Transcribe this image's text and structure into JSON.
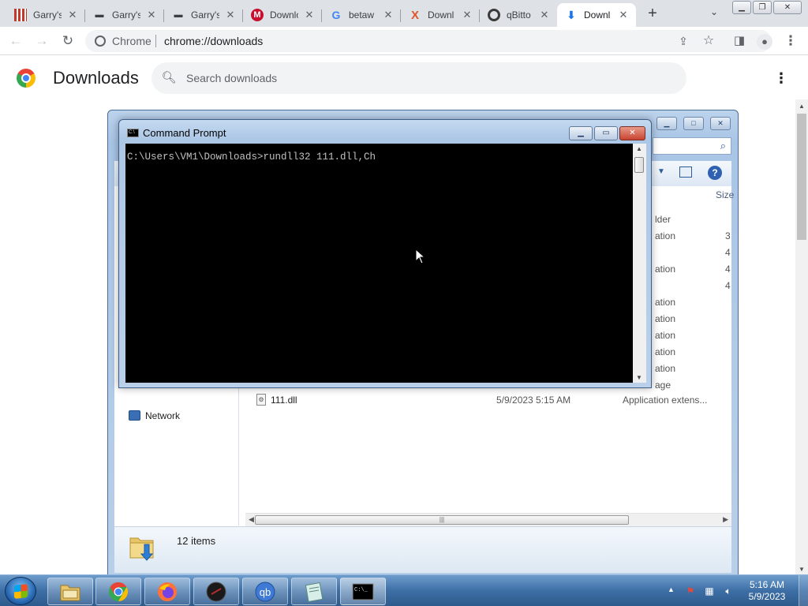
{
  "browser": {
    "tabs": [
      {
        "title": "Garry's",
        "favicon": "tartan-favicon"
      },
      {
        "title": "Garry's",
        "favicon": "dash-favicon"
      },
      {
        "title": "Garry's",
        "favicon": "dash-favicon"
      },
      {
        "title": "Downlo",
        "favicon": "malwarebytes-favicon"
      },
      {
        "title": "betaw",
        "favicon": "google-favicon"
      },
      {
        "title": "Downl",
        "favicon": "x-favicon"
      },
      {
        "title": "qBitto",
        "favicon": "qbittorrent-favicon"
      },
      {
        "title": "Downl",
        "favicon": "download-favicon",
        "active": true
      }
    ],
    "address": {
      "chip": "Chrome",
      "url": "chrome://downloads"
    }
  },
  "downloads_page": {
    "title": "Downloads",
    "search_placeholder": "Search downloads"
  },
  "explorer": {
    "column_size": "Size",
    "type_fragments": [
      "lder",
      "ation",
      "ation",
      "ation",
      "ation",
      "ation",
      "ation",
      "ation",
      "age"
    ],
    "size_fragments": [
      "3",
      "4",
      "4",
      "4"
    ],
    "file": {
      "name": "111.dll",
      "date": "5/9/2023 5:15 AM",
      "type": "Application extens..."
    },
    "nav_network": "Network",
    "status_count": "12 items"
  },
  "cmd": {
    "title": "Command Prompt",
    "line": "C:\\Users\\VM1\\Downloads>rundll32 111.dll,Ch"
  },
  "taskbar": {
    "apps": [
      "explorer",
      "chrome",
      "firefox",
      "app-dark",
      "qbittorrent",
      "notepad-like",
      "cmd"
    ],
    "time": "5:16 AM",
    "date": "5/9/2023"
  },
  "colors": {
    "tabstrip": "#dee1e6",
    "console_bg": "#000000",
    "console_text": "#c0c0c0",
    "taskbar": "#3d6fa6"
  }
}
